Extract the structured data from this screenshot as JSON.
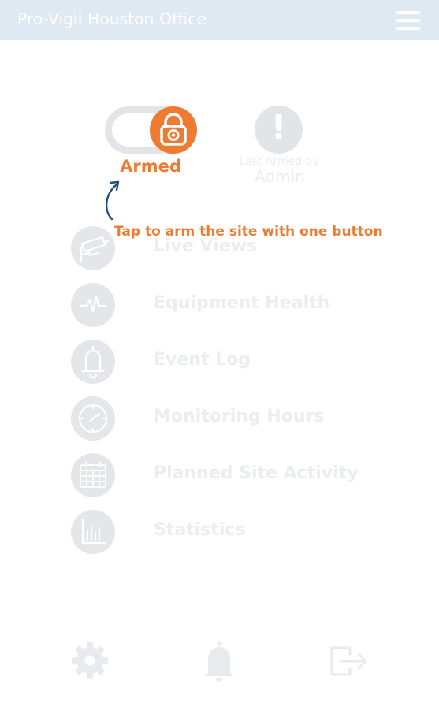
{
  "header": {
    "title": "Pro-Vigil Houston Office",
    "menu_icon": "hamburger-menu-icon"
  },
  "arm_control": {
    "state_label": "Armed",
    "is_armed": true,
    "icon": "lock-camera-icon",
    "accent_color": "#ef7b33"
  },
  "last_armed": {
    "icon": "exclamation-icon",
    "label": "Last Armed by",
    "user": "Admin"
  },
  "tip": {
    "text": "Tap to arm the site with one button",
    "color": "#ef7b33"
  },
  "menu": {
    "items": [
      {
        "label": "Live Views",
        "icon": "security-camera-icon"
      },
      {
        "label": "Equipment Health",
        "icon": "heartbeat-icon"
      },
      {
        "label": "Event Log",
        "icon": "bell-icon"
      },
      {
        "label": "Monitoring Hours",
        "icon": "clock-icon"
      },
      {
        "label": "Planned Site Activity",
        "icon": "calendar-icon"
      },
      {
        "label": "Statistics",
        "icon": "bar-chart-icon"
      }
    ]
  },
  "bottom_bar": {
    "items": [
      {
        "icon": "settings-gear-icon"
      },
      {
        "icon": "notifications-bell-icon"
      },
      {
        "icon": "logout-icon"
      }
    ]
  }
}
